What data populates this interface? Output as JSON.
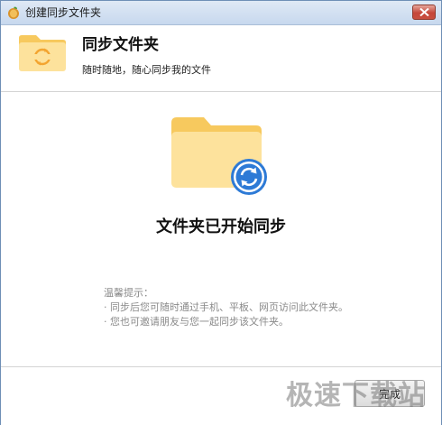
{
  "window": {
    "title": "创建同步文件夹"
  },
  "header": {
    "title": "同步文件夹",
    "subtitle": "随时随地，随心同步我的文件"
  },
  "main": {
    "status": "文件夹已开始同步"
  },
  "tips": {
    "heading": "温馨提示：",
    "items": [
      "· 同步后您可随时通过手机、平板、网页访问此文件夹。",
      "· 您也可邀请朋友与您一起同步该文件夹。"
    ]
  },
  "footer": {
    "finish_label": "完成"
  },
  "watermark": {
    "text": "极速下载站"
  },
  "colors": {
    "folder_back": "#f7c95e",
    "folder_front": "#fde29c",
    "sync_badge": "#2d7ad6",
    "header_sync": "#f3a531"
  }
}
